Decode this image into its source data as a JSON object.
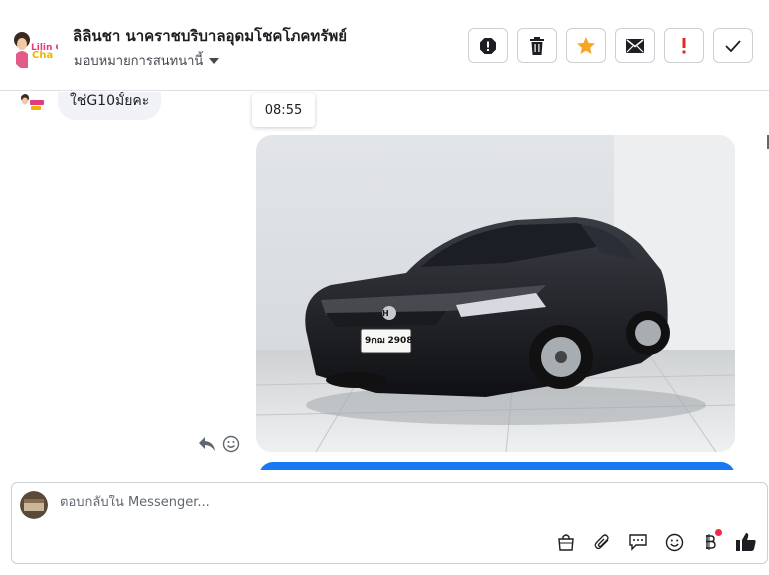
{
  "header": {
    "contact_name": "ลิลินชา นาคราชบริบาลอุดมโชคโภคทรัพย์",
    "assign_label": "มอบหมายการสนทนานี้",
    "actions": [
      "alert-icon",
      "trash-icon",
      "star-icon",
      "envelope-icon",
      "exclamation-icon",
      "check-icon"
    ],
    "colors": {
      "star": "#f5a623",
      "exclamation": "#e4262a"
    }
  },
  "conversation": {
    "incoming_text": "ใช่G10มั้ยคะ",
    "timestamp": "08:55",
    "photo_subject": "car-photo",
    "plate_text": "9กฌ 2908",
    "outgoing_bubble_color": "#1877f2"
  },
  "composer": {
    "placeholder": "ตอบกลับใน Messenger...",
    "tools": [
      "bag-icon",
      "paperclip-icon",
      "saved-replies-icon",
      "emoji-icon",
      "baht-icon",
      "thumbs-up-icon"
    ]
  },
  "avatar_text": "Lilin Cha"
}
